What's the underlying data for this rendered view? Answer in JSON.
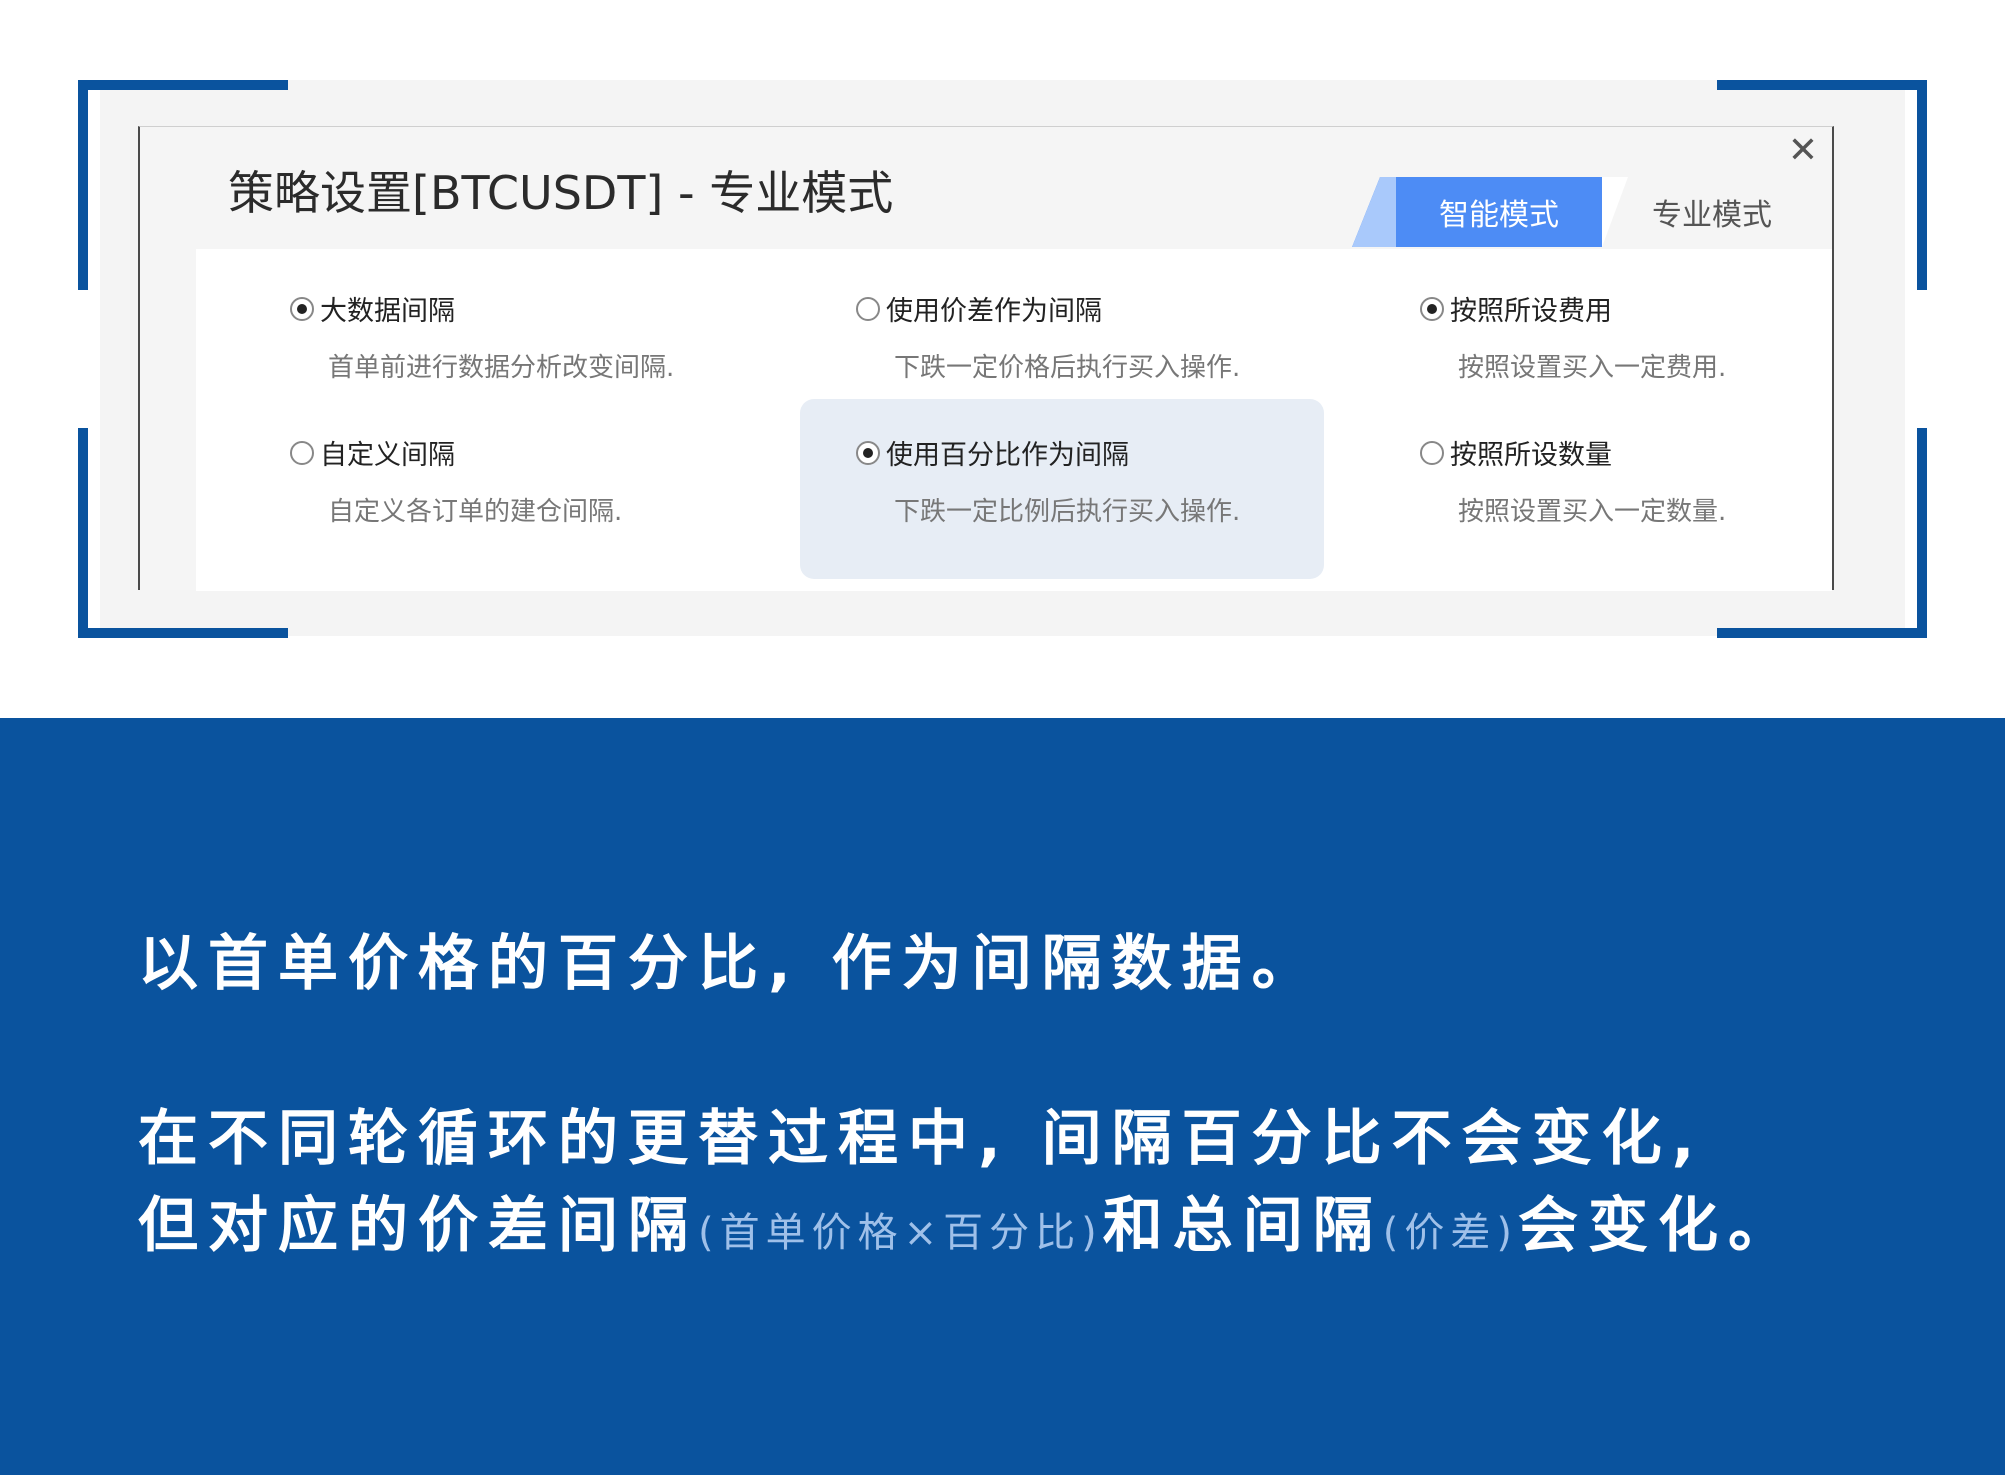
{
  "dialog": {
    "title": "策略设置[BTCUSDT] - 专业模式",
    "close_icon": "close-icon",
    "tabs": [
      {
        "label": "智能模式",
        "active": true
      },
      {
        "label": "专业模式",
        "active": false
      }
    ],
    "options": [
      {
        "title": "大数据间隔",
        "desc": "首单前进行数据分析改变间隔.",
        "checked": true
      },
      {
        "title": "使用价差作为间隔",
        "desc": "下跌一定价格后执行买入操作.",
        "checked": false
      },
      {
        "title": "按照所设费用",
        "desc": "按照设置买入一定费用.",
        "checked": true
      },
      {
        "title": "自定义间隔",
        "desc": "自定义各订单的建仓间隔.",
        "checked": false
      },
      {
        "title": "使用百分比作为间隔",
        "desc": "下跌一定比例后执行买入操作.",
        "checked": true
      },
      {
        "title": "按照所设数量",
        "desc": "按照设置买入一定数量.",
        "checked": false
      }
    ]
  },
  "caption": {
    "line1": "以首单价格的百分比, 作为间隔数据。",
    "line2": "在不同轮循环的更替过程中, 间隔百分比不会变化,",
    "line3_a": "但对应的价差间隔",
    "line3_b": "(首单价格×百分比)",
    "line3_c": "和总间隔",
    "line3_d": "(价差)",
    "line3_e": "会变化。"
  },
  "colors": {
    "brand_blue": "#0a539e",
    "tab_active": "#4d8cf5"
  }
}
